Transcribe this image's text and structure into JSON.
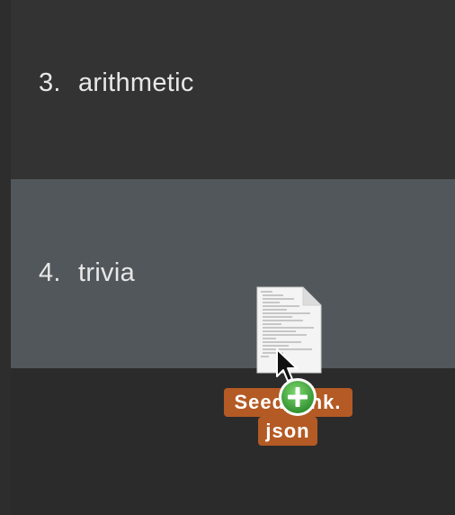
{
  "list": {
    "items": [
      {
        "number": "3.",
        "label": "arithmetic"
      },
      {
        "number": "4.",
        "label": "trivia"
      }
    ]
  },
  "drag": {
    "filename_line1": "Seedbank.",
    "filename_line2": "json",
    "badge_icon": "plus-circle-icon",
    "file_icon": "document-icon",
    "cursor_icon": "arrow-cursor-icon"
  },
  "colors": {
    "background": "#2b2b2b",
    "row": "#333333",
    "selected_row": "#51575a",
    "text": "#e8e8e8",
    "drag_label_bg": "#b45a24",
    "badge_green": "#3aa33a"
  }
}
